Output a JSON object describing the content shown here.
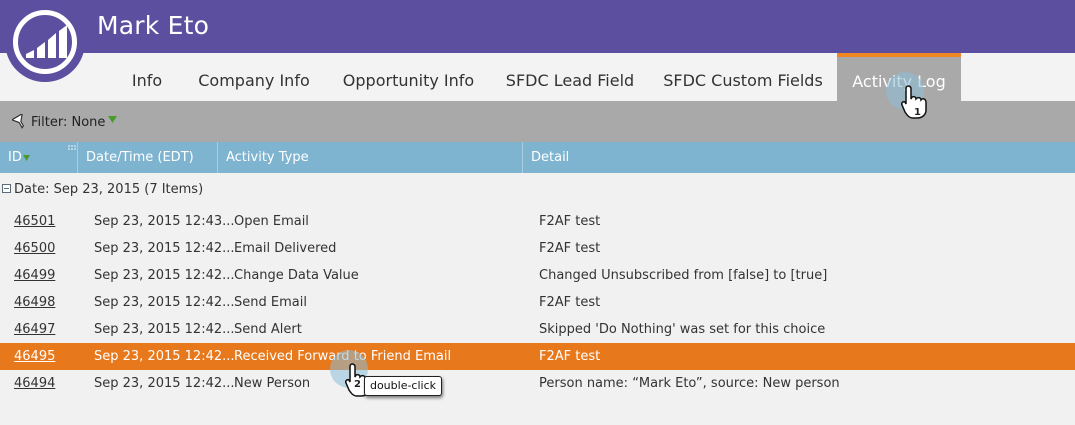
{
  "header": {
    "name": "Mark Eto"
  },
  "tabs": [
    {
      "label": "Info"
    },
    {
      "label": "Company Info"
    },
    {
      "label": "Opportunity Info"
    },
    {
      "label": "SFDC Lead Field"
    },
    {
      "label": "SFDC Custom Fields"
    },
    {
      "label": "Activity Log",
      "active": true
    }
  ],
  "filter": {
    "label": "Filter: None"
  },
  "columns": {
    "id": "ID",
    "date": "Date/Time (EDT)",
    "type": "Activity Type",
    "detail": "Detail"
  },
  "group": {
    "label": "Date: Sep 23, 2015 (7 Items)"
  },
  "rows": [
    {
      "id": "46501",
      "date": "Sep 23, 2015 12:43...",
      "type": "Open Email",
      "detail": "F2AF test"
    },
    {
      "id": "46500",
      "date": "Sep 23, 2015 12:42...",
      "type": "Email Delivered",
      "detail": "F2AF test"
    },
    {
      "id": "46499",
      "date": "Sep 23, 2015 12:42...",
      "type": "Change Data Value",
      "detail": "Changed Unsubscribed from [false] to [true]"
    },
    {
      "id": "46498",
      "date": "Sep 23, 2015 12:42...",
      "type": "Send Email",
      "detail": "F2AF test"
    },
    {
      "id": "46497",
      "date": "Sep 23, 2015 12:42...",
      "type": "Send Alert",
      "detail": "Skipped 'Do Nothing' was set for this choice"
    },
    {
      "id": "46495",
      "date": "Sep 23, 2015 12:42...",
      "type": "Received Forward to Friend Email",
      "detail": "F2AF test",
      "selected": true
    },
    {
      "id": "46494",
      "date": "Sep 23, 2015 12:42...",
      "type": "New Person",
      "detail": "Person name: “Mark Eto”, source: New person"
    }
  ],
  "annotations": {
    "step1": "1",
    "step2": "2",
    "callout": "double-click"
  },
  "colors": {
    "header": "#5c4fa0",
    "active_tab_accent": "#f08722",
    "selected_row": "#e8781c",
    "column_header": "#7fb4d0"
  }
}
